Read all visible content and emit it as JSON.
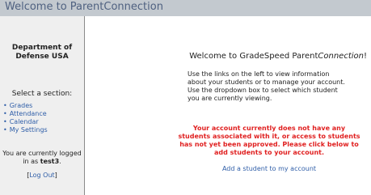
{
  "header": {
    "title": "Welcome to ParentConnection"
  },
  "sidebar": {
    "department": "Department of Defense USA",
    "select_label": "Select a section:",
    "nav": [
      {
        "label": "Grades"
      },
      {
        "label": "Attendance"
      },
      {
        "label": "Calendar"
      },
      {
        "label": "My Settings"
      }
    ],
    "logged_in_prefix": "You are currently logged in as",
    "username": "test3",
    "logout_open": "[",
    "logout_label": "Log Out",
    "logout_close": "]"
  },
  "main": {
    "welcome_prefix": "Welcome to GradeSpeed Parent",
    "welcome_italic": "Connection",
    "welcome_suffix": "!",
    "intro": "Use the links on the left to view information about your students or to manage your account.   Use the dropdown box to select which student you are currently viewing.",
    "warning": "Your account currently does not have any students associated with it, or access to students has not yet been approved. Please click below to add students to your account.",
    "add_student_link": "Add a student to my account"
  },
  "colors": {
    "header_bg": "#c3c9cf",
    "header_text": "#4f6180",
    "link": "#2f5ea8",
    "warning": "#e02020",
    "sidebar_bg": "#efefef"
  }
}
